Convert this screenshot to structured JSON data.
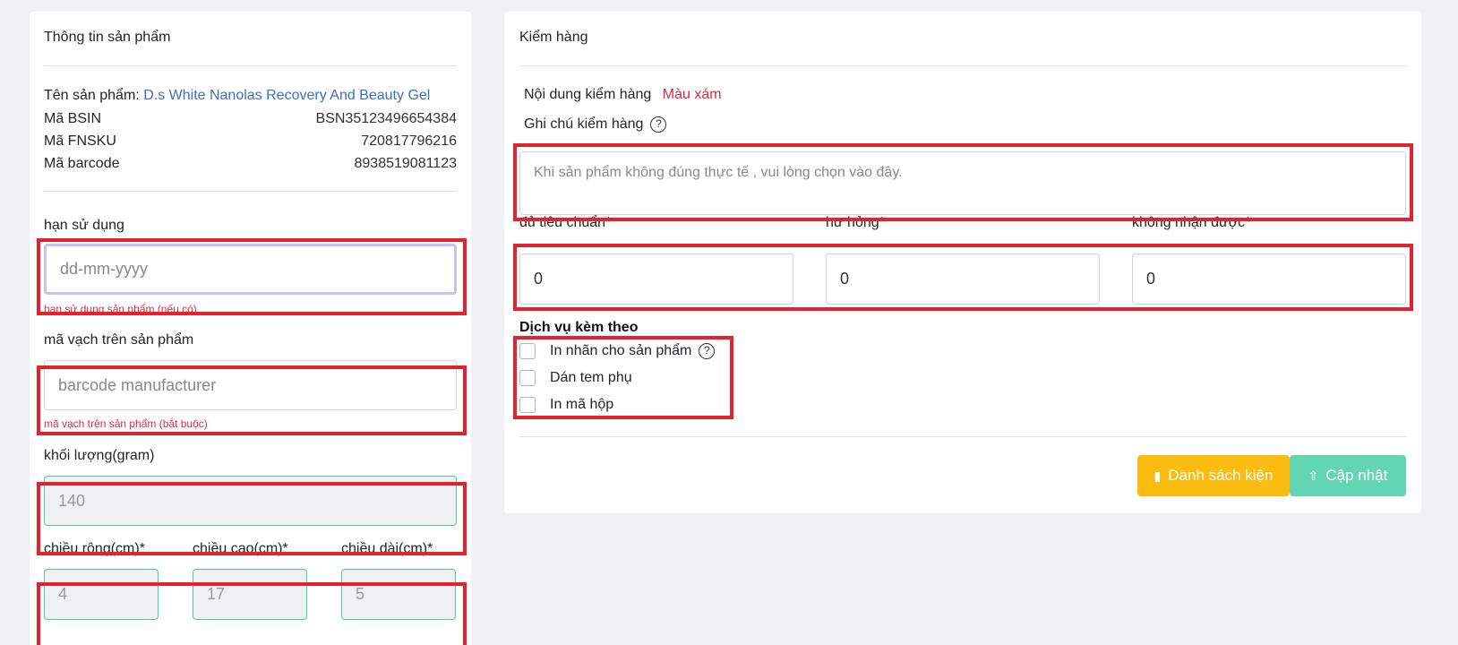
{
  "left": {
    "title": "Thông tin sản phẩm",
    "product_name_label": "Tên sản phẩm:",
    "product_name": "D.s White Nanolas Recovery And Beauty Gel",
    "bsin_label": "Mã BSIN",
    "bsin": "BSN35123496654384",
    "fnsku_label": "Mã FNSKU",
    "fnsku": "720817796216",
    "barcode_label": "Mã barcode",
    "barcode": "8938519081123",
    "expiry_label": "hạn sử dụng",
    "expiry_placeholder": "dd-mm-yyyy",
    "expiry_hint": "hạn sử dụng sản phẩm (nếu có)",
    "mfr_barcode_label": "mã vạch trên sản phẩm",
    "mfr_barcode_placeholder": "barcode manufacturer",
    "mfr_barcode_hint": "mã vạch trên sản phẩm (bắt buộc)",
    "weight_label": "khối lượng(gram)",
    "weight_value": "140",
    "width_label": "chiều rộng(cm)*",
    "width_value": "4",
    "height_label": "chiều cao(cm)*",
    "height_value": "17",
    "length_label": "chiều dài(cm)*",
    "length_value": "5"
  },
  "right": {
    "title": "Kiểm hàng",
    "check_content_label": "Nội dung kiểm hàng",
    "check_content_value": "Màu xám",
    "note_label": "Ghi chú kiểm hàng",
    "note_placeholder": "Khi sản phẩm không đúng thực tế , vui lòng chọn vào đây.",
    "qty_ok_label": "đủ tiêu chuẩn*",
    "qty_ok_value": "0",
    "qty_damaged_label": "hư hỏng*",
    "qty_damaged_value": "0",
    "qty_missing_label": "không nhận được*",
    "qty_missing_value": "0",
    "services_title": "Dịch vụ kèm theo",
    "services": [
      {
        "label": "In nhãn cho sản phẩm"
      },
      {
        "label": "Dán tem phụ"
      },
      {
        "label": "In mã hộp"
      }
    ],
    "btn_packages": "Danh sách kiện",
    "btn_update": "Cập nhật",
    "help_icon": "?"
  }
}
